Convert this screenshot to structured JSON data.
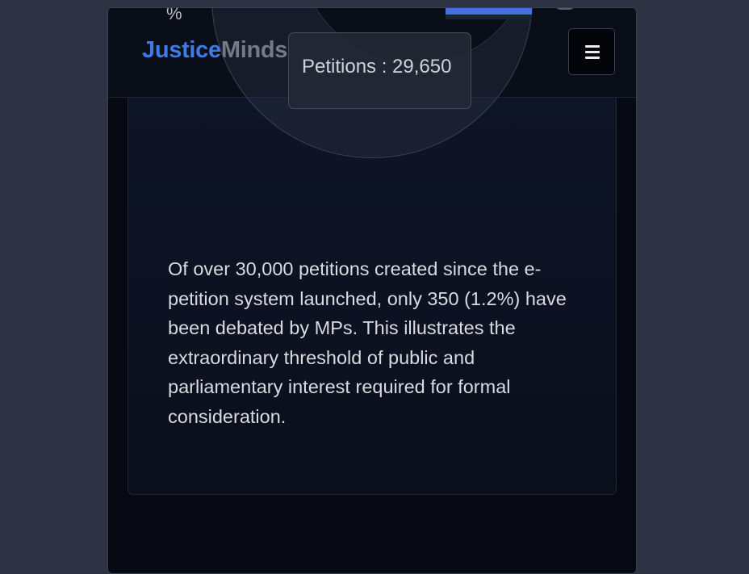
{
  "brand": {
    "part1": "Justice",
    "part2": "Minds"
  },
  "nav": {
    "menu_icon": "hamburger-menu-icon"
  },
  "chart_overlay": {
    "percent_fragment": "%",
    "tooltip_label": "Petitions : 29,650",
    "accent_color": "#3f72dc"
  },
  "card": {
    "text": "Of over 30,000 petitions created since the e-petition system launched, only 350 (1.2%) have been debated by MPs. This illustrates the extraordinary threshold of public and parliamentary interest required for formal consideration."
  }
}
